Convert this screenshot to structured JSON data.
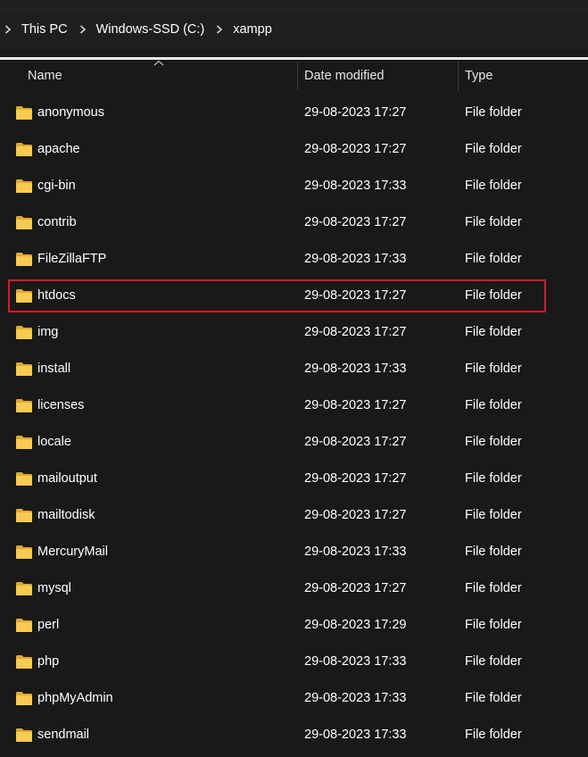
{
  "breadcrumb": {
    "items": [
      "This PC",
      "Windows-SSD (C:)",
      "xampp"
    ]
  },
  "columns": {
    "name": "Name",
    "date": "Date modified",
    "type": "Type"
  },
  "rows": [
    {
      "name": "anonymous",
      "date": "29-08-2023 17:27",
      "type": "File folder"
    },
    {
      "name": "apache",
      "date": "29-08-2023 17:27",
      "type": "File folder"
    },
    {
      "name": "cgi-bin",
      "date": "29-08-2023 17:33",
      "type": "File folder"
    },
    {
      "name": "contrib",
      "date": "29-08-2023 17:27",
      "type": "File folder"
    },
    {
      "name": "FileZillaFTP",
      "date": "29-08-2023 17:33",
      "type": "File folder"
    },
    {
      "name": "htdocs",
      "date": "29-08-2023 17:27",
      "type": "File folder"
    },
    {
      "name": "img",
      "date": "29-08-2023 17:27",
      "type": "File folder"
    },
    {
      "name": "install",
      "date": "29-08-2023 17:33",
      "type": "File folder"
    },
    {
      "name": "licenses",
      "date": "29-08-2023 17:27",
      "type": "File folder"
    },
    {
      "name": "locale",
      "date": "29-08-2023 17:27",
      "type": "File folder"
    },
    {
      "name": "mailoutput",
      "date": "29-08-2023 17:27",
      "type": "File folder"
    },
    {
      "name": "mailtodisk",
      "date": "29-08-2023 17:27",
      "type": "File folder"
    },
    {
      "name": "MercuryMail",
      "date": "29-08-2023 17:33",
      "type": "File folder"
    },
    {
      "name": "mysql",
      "date": "29-08-2023 17:27",
      "type": "File folder"
    },
    {
      "name": "perl",
      "date": "29-08-2023 17:29",
      "type": "File folder"
    },
    {
      "name": "php",
      "date": "29-08-2023 17:33",
      "type": "File folder"
    },
    {
      "name": "phpMyAdmin",
      "date": "29-08-2023 17:33",
      "type": "File folder"
    },
    {
      "name": "sendmail",
      "date": "29-08-2023 17:33",
      "type": "File folder"
    }
  ],
  "highlighted_row": "htdocs",
  "icons": {
    "folder": "folder-icon",
    "breadcrumb_separator": "chevron-right-icon",
    "sort": "sort-ascending-icon"
  },
  "colors": {
    "background": "#191919",
    "folder": "#f4c84a",
    "highlight_border": "#d41b24"
  }
}
